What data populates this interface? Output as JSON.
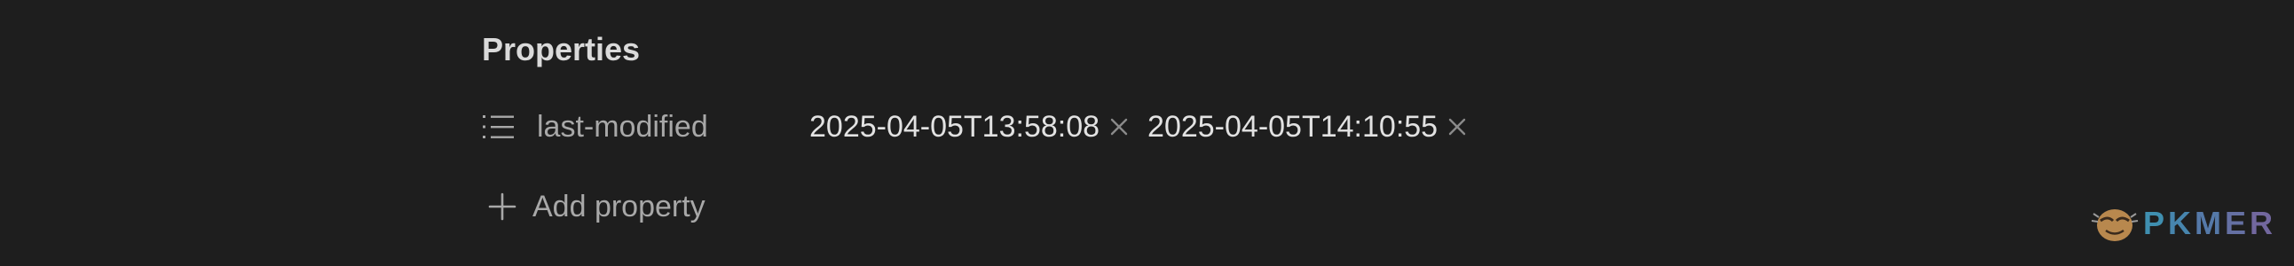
{
  "properties": {
    "title": "Properties",
    "rows": [
      {
        "icon": "list-icon",
        "key": "last-modified",
        "values": [
          "2025-04-05T13:58:08",
          "2025-04-05T14:10:55"
        ]
      }
    ],
    "add_label": "Add property"
  },
  "watermark": {
    "letters": [
      "P",
      "K",
      "M",
      "E",
      "R"
    ]
  },
  "colors": {
    "background": "#1e1e1e",
    "title": "#dadada",
    "muted": "#a8a8a8",
    "value": "#e2e2e2"
  }
}
